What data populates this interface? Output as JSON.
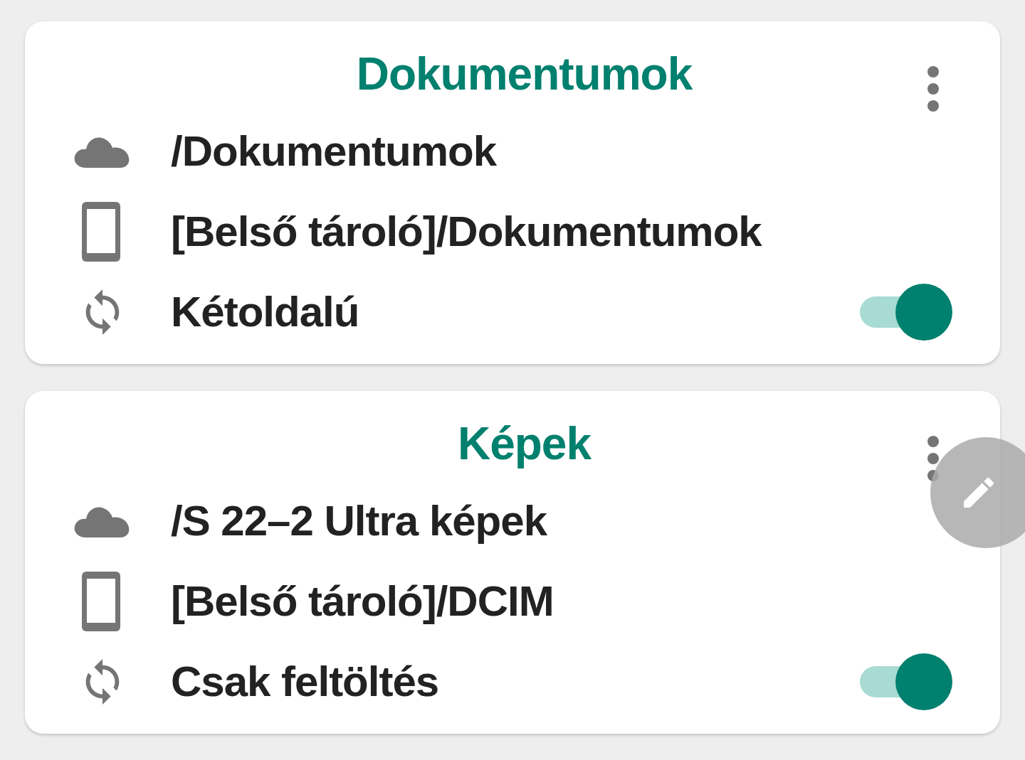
{
  "folders": [
    {
      "title": "Dokumentumok",
      "remote": "/Dokumentumok",
      "local": "[Belső tároló]/Dokumentumok",
      "mode": "Kétoldalú",
      "enabled": true
    },
    {
      "title": "Képek",
      "remote": "/S 22–2 Ultra képek",
      "local": "[Belső tároló]/DCIM",
      "mode": "Csak feltöltés",
      "enabled": true
    }
  ]
}
